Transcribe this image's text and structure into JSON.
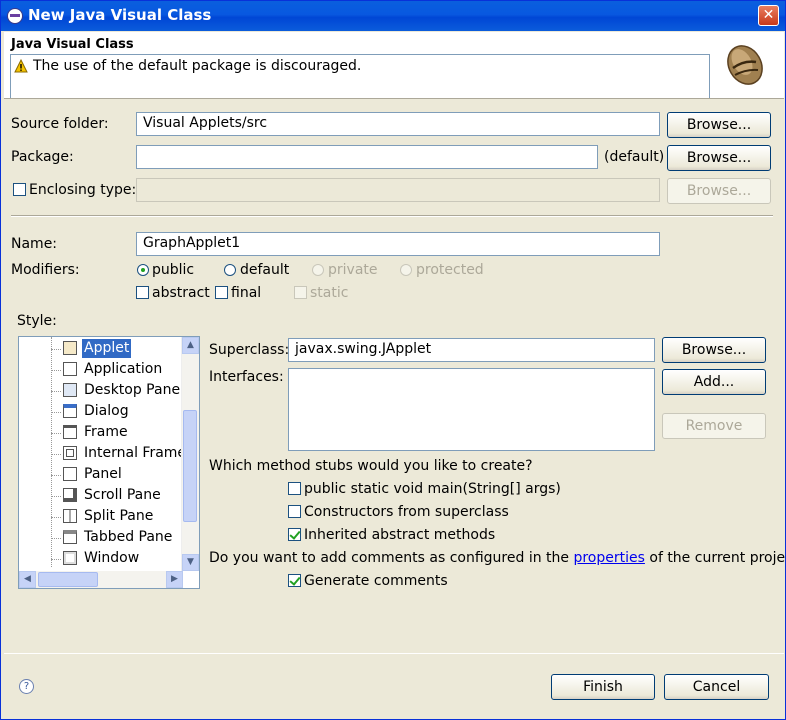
{
  "window": {
    "title": "New Java Visual Class",
    "close_symbol": "✕"
  },
  "header": {
    "title": "Java Visual Class",
    "message": "The use of the default package is discouraged."
  },
  "source_folder": {
    "label": "Source folder:",
    "value": "Visual Applets/src",
    "browse": "Browse..."
  },
  "package": {
    "label": "Package:",
    "value": "",
    "default_label": "(default)",
    "browse": "Browse..."
  },
  "enclosing": {
    "label": "Enclosing type:",
    "value": "",
    "browse": "Browse..."
  },
  "name": {
    "label": "Name:",
    "value": "GraphApplet1"
  },
  "modifiers": {
    "label": "Modifiers:",
    "public": "public",
    "default": "default",
    "private": "private",
    "protected": "protected",
    "abstract": "abstract",
    "final": "final",
    "static": "static"
  },
  "style": {
    "label": "Style:",
    "items": [
      "Applet",
      "Application",
      "Desktop Pane",
      "Dialog",
      "Frame",
      "Internal Frame",
      "Panel",
      "Scroll Pane",
      "Split Pane",
      "Tabbed Pane",
      "Window"
    ],
    "selected": "Applet"
  },
  "superclass": {
    "label": "Superclass:",
    "value": "javax.swing.JApplet",
    "browse": "Browse..."
  },
  "interfaces": {
    "label": "Interfaces:",
    "add": "Add...",
    "remove": "Remove"
  },
  "stubs": {
    "question": "Which method stubs would you like to create?",
    "main": "public static void main(String[] args)",
    "constructors": "Constructors from superclass",
    "inherited": "Inherited abstract methods"
  },
  "comments": {
    "question_before": "Do you want to add comments as configured in the",
    "link": "properties",
    "question_after": "of the current project?",
    "generate": "Generate comments"
  },
  "footer": {
    "help_symbol": "?",
    "finish": "Finish",
    "cancel": "Cancel"
  }
}
